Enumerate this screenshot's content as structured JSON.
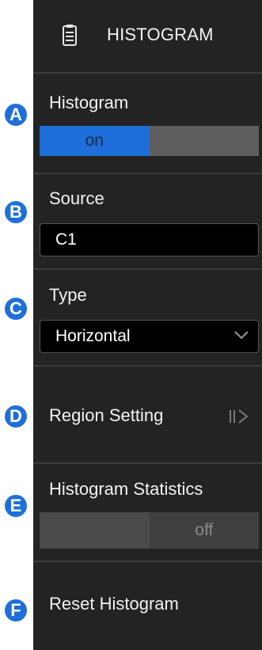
{
  "header": {
    "title": "HISTOGRAM",
    "icon": "menu-document-icon"
  },
  "histogram": {
    "label": "Histogram",
    "on_label": "on",
    "state": "on"
  },
  "source": {
    "label": "Source",
    "value": "C1"
  },
  "type": {
    "label": "Type",
    "value": "Horizontal"
  },
  "region": {
    "label": "Region Setting"
  },
  "stats": {
    "label": "Histogram Statistics",
    "off_label": "off",
    "state": "off"
  },
  "reset": {
    "label": "Reset Histogram"
  },
  "markers": [
    "A",
    "B",
    "C",
    "D",
    "E",
    "F"
  ],
  "colors": {
    "accent": "#1e6fd9",
    "panel": "#232323"
  }
}
